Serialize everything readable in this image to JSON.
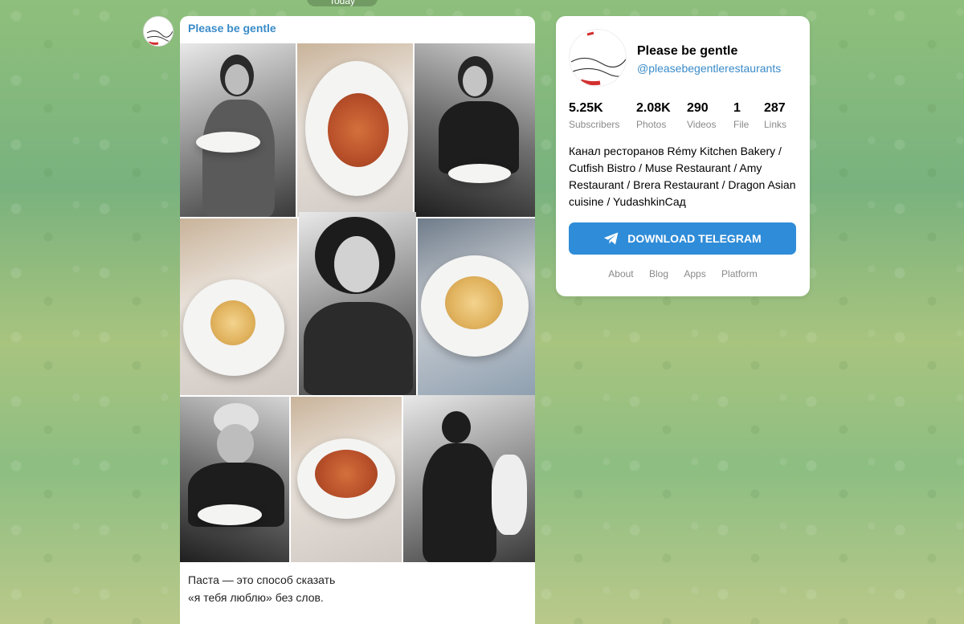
{
  "date_pill": "Today",
  "post": {
    "author": "Please be gentle",
    "caption_line1": "Паста — это способ сказать",
    "caption_line2": "«я тебя люблю» без слов."
  },
  "card": {
    "title": "Please be gentle",
    "handle": "@pleasebegentlerestaurants",
    "stats": [
      {
        "value": "5.25K",
        "label": "Subscribers"
      },
      {
        "value": "2.08K",
        "label": "Photos"
      },
      {
        "value": "290",
        "label": "Videos"
      },
      {
        "value": "1",
        "label": "File"
      },
      {
        "value": "287",
        "label": "Links"
      }
    ],
    "description": "Канал ресторанов Rémy Kitchen Bakery / Cutfish Bistro / Muse Restaurant / Amy Restaurant / Brera Restaurant / Dragon Asian cuisine / YudashkinСад",
    "download_label": "DOWNLOAD TELEGRAM",
    "footer_links": [
      "About",
      "Blog",
      "Apps",
      "Platform"
    ]
  },
  "colors": {
    "accent": "#2f8cd8",
    "link": "#3a8bc8"
  },
  "icons": {
    "download": "telegram-plane-icon"
  }
}
